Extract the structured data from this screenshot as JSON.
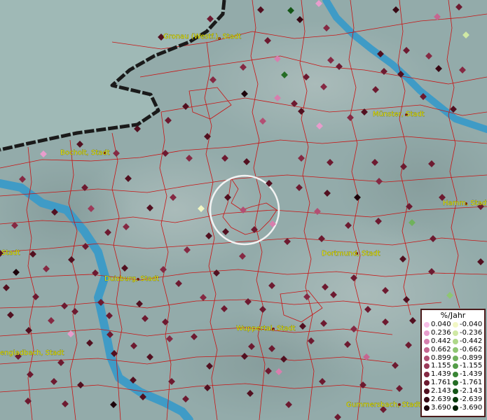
{
  "cities": [
    {
      "name": "Gronau (Westf.), Stadt"
    },
    {
      "name": "Bocholt, Stadt"
    },
    {
      "name": "Münster, Stadt"
    },
    {
      "name": "Hamm, Stadt"
    },
    {
      "name": "Stadt"
    },
    {
      "name": "Dortmund, Stadt"
    },
    {
      "name": "Duisburg, Stadt"
    },
    {
      "name": "Wuppertal, Stadt"
    },
    {
      "name": "engladbach, Stadt"
    },
    {
      "name": "Gummersbach, Stadt"
    }
  ],
  "legend": {
    "title": "%/Jahr",
    "positive": [
      "0.040",
      "0.236",
      "0.442",
      "0.662",
      "0.899",
      "1.155",
      "1.439",
      "1.761",
      "2.143",
      "2.639",
      "3.690"
    ],
    "negative": [
      "-0.040",
      "-0.236",
      "-0.442",
      "-0.662",
      "-0.899",
      "-1.155",
      "-1.439",
      "-1.761",
      "-2.143",
      "-2.639",
      "-3.690"
    ],
    "positive_colors": [
      "#f7bde6",
      "#e89ccc",
      "#d77fae",
      "#c66690",
      "#b24f73",
      "#9c3a59",
      "#852943",
      "#6d1a30",
      "#521020",
      "#380814",
      "#1c020a"
    ],
    "negative_colors": [
      "#f2f7c4",
      "#cfe8a4",
      "#aed889",
      "#8ec672",
      "#70b25c",
      "#539c47",
      "#3a8535",
      "#256d25",
      "#145516",
      "#083c0b",
      "#022104"
    ]
  }
}
